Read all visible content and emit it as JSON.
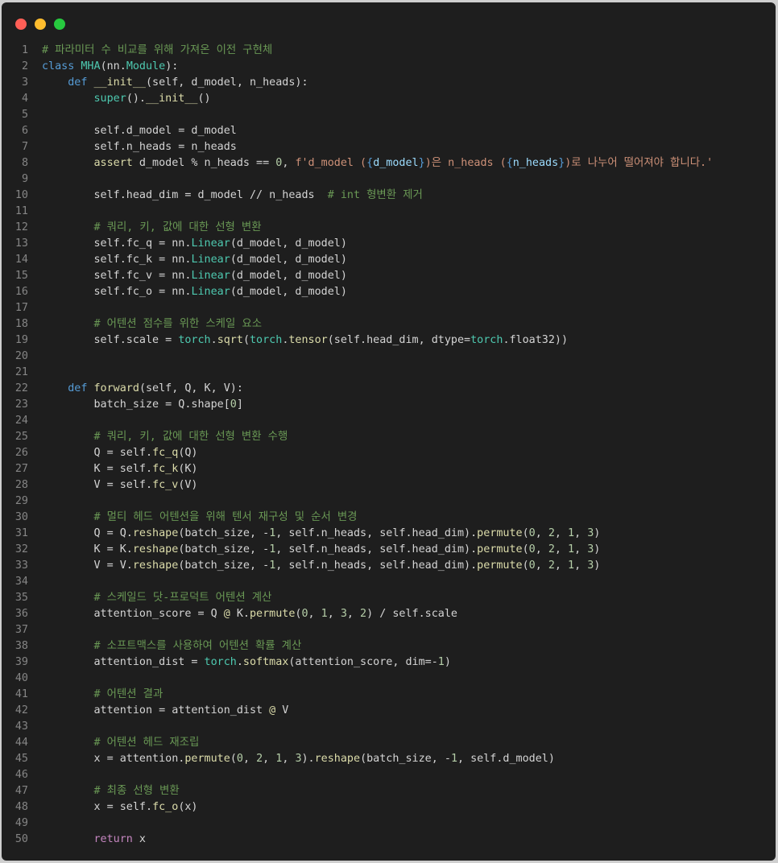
{
  "window": {
    "controls": {
      "close": "#ff5f56",
      "minimize": "#ffbd2e",
      "maximize": "#27c93f"
    },
    "background": "#1e1e1e"
  },
  "colors": {
    "comment": "#6a9955",
    "keyword": "#569cd6",
    "control": "#c586c0",
    "function": "#dcdcaa",
    "class": "#4ec9b0",
    "variable": "#9cdcfe",
    "number": "#b5cea8",
    "string": "#ce9178",
    "plain": "#d4d4d4",
    "line_number": "#858585"
  },
  "code": {
    "language": "python",
    "lines": [
      {
        "n": "1",
        "tokens": [
          [
            "comment",
            "# 파라미터 수 비교를 위해 가져온 이전 구현체"
          ]
        ]
      },
      {
        "n": "2",
        "tokens": [
          [
            "keyword",
            "class"
          ],
          [
            "plain",
            " "
          ],
          [
            "class",
            "MHA"
          ],
          [
            "plain",
            "(nn."
          ],
          [
            "class",
            "Module"
          ],
          [
            "plain",
            "):"
          ]
        ]
      },
      {
        "n": "3",
        "tokens": [
          [
            "plain",
            "    "
          ],
          [
            "keyword",
            "def"
          ],
          [
            "plain",
            " "
          ],
          [
            "function",
            "__init__"
          ],
          [
            "plain",
            "(self, d_model, n_heads):"
          ]
        ]
      },
      {
        "n": "4",
        "tokens": [
          [
            "plain",
            "        "
          ],
          [
            "class",
            "super"
          ],
          [
            "plain",
            "()."
          ],
          [
            "function",
            "__init__"
          ],
          [
            "plain",
            "()"
          ]
        ]
      },
      {
        "n": "5",
        "tokens": []
      },
      {
        "n": "6",
        "tokens": [
          [
            "plain",
            "        self.d_model = d_model"
          ]
        ]
      },
      {
        "n": "7",
        "tokens": [
          [
            "plain",
            "        self.n_heads = n_heads"
          ]
        ]
      },
      {
        "n": "8",
        "tokens": [
          [
            "plain",
            "        "
          ],
          [
            "function",
            "assert"
          ],
          [
            "plain",
            " d_model % n_heads == "
          ],
          [
            "number",
            "0"
          ],
          [
            "plain",
            ", "
          ],
          [
            "string",
            "f'd_model ("
          ],
          [
            "keyword",
            "{"
          ],
          [
            "variable",
            "d_model"
          ],
          [
            "keyword",
            "}"
          ],
          [
            "string",
            ")은 n_heads ("
          ],
          [
            "keyword",
            "{"
          ],
          [
            "variable",
            "n_heads"
          ],
          [
            "keyword",
            "}"
          ],
          [
            "string",
            ")로 나누어 떨어져야 합니다.'"
          ]
        ]
      },
      {
        "n": "9",
        "tokens": []
      },
      {
        "n": "10",
        "tokens": [
          [
            "plain",
            "        self.head_dim = d_model // n_heads  "
          ],
          [
            "comment",
            "# int 형변환 제거"
          ]
        ]
      },
      {
        "n": "11",
        "tokens": []
      },
      {
        "n": "12",
        "tokens": [
          [
            "plain",
            "        "
          ],
          [
            "comment",
            "# 쿼리, 키, 값에 대한 선형 변환"
          ]
        ]
      },
      {
        "n": "13",
        "tokens": [
          [
            "plain",
            "        self.fc_q = nn."
          ],
          [
            "class",
            "Linear"
          ],
          [
            "plain",
            "(d_model, d_model)"
          ]
        ]
      },
      {
        "n": "14",
        "tokens": [
          [
            "plain",
            "        self.fc_k = nn."
          ],
          [
            "class",
            "Linear"
          ],
          [
            "plain",
            "(d_model, d_model)"
          ]
        ]
      },
      {
        "n": "15",
        "tokens": [
          [
            "plain",
            "        self.fc_v = nn."
          ],
          [
            "class",
            "Linear"
          ],
          [
            "plain",
            "(d_model, d_model)"
          ]
        ]
      },
      {
        "n": "16",
        "tokens": [
          [
            "plain",
            "        self.fc_o = nn."
          ],
          [
            "class",
            "Linear"
          ],
          [
            "plain",
            "(d_model, d_model)"
          ]
        ]
      },
      {
        "n": "17",
        "tokens": []
      },
      {
        "n": "18",
        "tokens": [
          [
            "plain",
            "        "
          ],
          [
            "comment",
            "# 어텐션 점수를 위한 스케일 요소"
          ]
        ]
      },
      {
        "n": "19",
        "tokens": [
          [
            "plain",
            "        self.scale = "
          ],
          [
            "class",
            "torch"
          ],
          [
            "plain",
            "."
          ],
          [
            "function",
            "sqrt"
          ],
          [
            "plain",
            "("
          ],
          [
            "class",
            "torch"
          ],
          [
            "plain",
            "."
          ],
          [
            "function",
            "tensor"
          ],
          [
            "plain",
            "(self.head_dim, dtype="
          ],
          [
            "class",
            "torch"
          ],
          [
            "plain",
            ".float32))"
          ]
        ]
      },
      {
        "n": "20",
        "tokens": []
      },
      {
        "n": "21",
        "tokens": []
      },
      {
        "n": "22",
        "tokens": [
          [
            "plain",
            "    "
          ],
          [
            "keyword",
            "def"
          ],
          [
            "plain",
            " "
          ],
          [
            "function",
            "forward"
          ],
          [
            "plain",
            "(self, Q, K, V):"
          ]
        ]
      },
      {
        "n": "23",
        "tokens": [
          [
            "plain",
            "        batch_size = Q.shape["
          ],
          [
            "number",
            "0"
          ],
          [
            "plain",
            "]"
          ]
        ]
      },
      {
        "n": "24",
        "tokens": []
      },
      {
        "n": "25",
        "tokens": [
          [
            "plain",
            "        "
          ],
          [
            "comment",
            "# 쿼리, 키, 값에 대한 선형 변환 수행"
          ]
        ]
      },
      {
        "n": "26",
        "tokens": [
          [
            "plain",
            "        Q = self."
          ],
          [
            "function",
            "fc_q"
          ],
          [
            "plain",
            "(Q)"
          ]
        ]
      },
      {
        "n": "27",
        "tokens": [
          [
            "plain",
            "        K = self."
          ],
          [
            "function",
            "fc_k"
          ],
          [
            "plain",
            "(K)"
          ]
        ]
      },
      {
        "n": "28",
        "tokens": [
          [
            "plain",
            "        V = self."
          ],
          [
            "function",
            "fc_v"
          ],
          [
            "plain",
            "(V)"
          ]
        ]
      },
      {
        "n": "29",
        "tokens": []
      },
      {
        "n": "30",
        "tokens": [
          [
            "plain",
            "        "
          ],
          [
            "comment",
            "# 멀티 헤드 어텐션을 위해 텐서 재구성 및 순서 변경"
          ]
        ]
      },
      {
        "n": "31",
        "tokens": [
          [
            "plain",
            "        Q = Q."
          ],
          [
            "function",
            "reshape"
          ],
          [
            "plain",
            "(batch_size, -"
          ],
          [
            "number",
            "1"
          ],
          [
            "plain",
            ", self.n_heads, self.head_dim)."
          ],
          [
            "function",
            "permute"
          ],
          [
            "plain",
            "("
          ],
          [
            "number",
            "0"
          ],
          [
            "plain",
            ", "
          ],
          [
            "number",
            "2"
          ],
          [
            "plain",
            ", "
          ],
          [
            "number",
            "1"
          ],
          [
            "plain",
            ", "
          ],
          [
            "number",
            "3"
          ],
          [
            "plain",
            ")"
          ]
        ]
      },
      {
        "n": "32",
        "tokens": [
          [
            "plain",
            "        K = K."
          ],
          [
            "function",
            "reshape"
          ],
          [
            "plain",
            "(batch_size, -"
          ],
          [
            "number",
            "1"
          ],
          [
            "plain",
            ", self.n_heads, self.head_dim)."
          ],
          [
            "function",
            "permute"
          ],
          [
            "plain",
            "("
          ],
          [
            "number",
            "0"
          ],
          [
            "plain",
            ", "
          ],
          [
            "number",
            "2"
          ],
          [
            "plain",
            ", "
          ],
          [
            "number",
            "1"
          ],
          [
            "plain",
            ", "
          ],
          [
            "number",
            "3"
          ],
          [
            "plain",
            ")"
          ]
        ]
      },
      {
        "n": "33",
        "tokens": [
          [
            "plain",
            "        V = V."
          ],
          [
            "function",
            "reshape"
          ],
          [
            "plain",
            "(batch_size, -"
          ],
          [
            "number",
            "1"
          ],
          [
            "plain",
            ", self.n_heads, self.head_dim)."
          ],
          [
            "function",
            "permute"
          ],
          [
            "plain",
            "("
          ],
          [
            "number",
            "0"
          ],
          [
            "plain",
            ", "
          ],
          [
            "number",
            "2"
          ],
          [
            "plain",
            ", "
          ],
          [
            "number",
            "1"
          ],
          [
            "plain",
            ", "
          ],
          [
            "number",
            "3"
          ],
          [
            "plain",
            ")"
          ]
        ]
      },
      {
        "n": "34",
        "tokens": []
      },
      {
        "n": "35",
        "tokens": [
          [
            "plain",
            "        "
          ],
          [
            "comment",
            "# 스케일드 닷-프로덕트 어텐션 계산"
          ]
        ]
      },
      {
        "n": "36",
        "tokens": [
          [
            "plain",
            "        attention_score = Q "
          ],
          [
            "function",
            "@"
          ],
          [
            "plain",
            " K."
          ],
          [
            "function",
            "permute"
          ],
          [
            "plain",
            "("
          ],
          [
            "number",
            "0"
          ],
          [
            "plain",
            ", "
          ],
          [
            "number",
            "1"
          ],
          [
            "plain",
            ", "
          ],
          [
            "number",
            "3"
          ],
          [
            "plain",
            ", "
          ],
          [
            "number",
            "2"
          ],
          [
            "plain",
            ") / self.scale"
          ]
        ]
      },
      {
        "n": "37",
        "tokens": []
      },
      {
        "n": "38",
        "tokens": [
          [
            "plain",
            "        "
          ],
          [
            "comment",
            "# 소프트맥스를 사용하여 어텐션 확률 계산"
          ]
        ]
      },
      {
        "n": "39",
        "tokens": [
          [
            "plain",
            "        attention_dist = "
          ],
          [
            "class",
            "torch"
          ],
          [
            "plain",
            "."
          ],
          [
            "function",
            "softmax"
          ],
          [
            "plain",
            "(attention_score, dim=-"
          ],
          [
            "number",
            "1"
          ],
          [
            "plain",
            ")"
          ]
        ]
      },
      {
        "n": "40",
        "tokens": []
      },
      {
        "n": "41",
        "tokens": [
          [
            "plain",
            "        "
          ],
          [
            "comment",
            "# 어텐션 결과"
          ]
        ]
      },
      {
        "n": "42",
        "tokens": [
          [
            "plain",
            "        attention = attention_dist "
          ],
          [
            "function",
            "@"
          ],
          [
            "plain",
            " V"
          ]
        ]
      },
      {
        "n": "43",
        "tokens": []
      },
      {
        "n": "44",
        "tokens": [
          [
            "plain",
            "        "
          ],
          [
            "comment",
            "# 어텐션 헤드 재조립"
          ]
        ]
      },
      {
        "n": "45",
        "tokens": [
          [
            "plain",
            "        x = attention."
          ],
          [
            "function",
            "permute"
          ],
          [
            "plain",
            "("
          ],
          [
            "number",
            "0"
          ],
          [
            "plain",
            ", "
          ],
          [
            "number",
            "2"
          ],
          [
            "plain",
            ", "
          ],
          [
            "number",
            "1"
          ],
          [
            "plain",
            ", "
          ],
          [
            "number",
            "3"
          ],
          [
            "plain",
            ")."
          ],
          [
            "function",
            "reshape"
          ],
          [
            "plain",
            "(batch_size, -"
          ],
          [
            "number",
            "1"
          ],
          [
            "plain",
            ", self.d_model)"
          ]
        ]
      },
      {
        "n": "46",
        "tokens": []
      },
      {
        "n": "47",
        "tokens": [
          [
            "plain",
            "        "
          ],
          [
            "comment",
            "# 최종 선형 변환"
          ]
        ]
      },
      {
        "n": "48",
        "tokens": [
          [
            "plain",
            "        x = self."
          ],
          [
            "function",
            "fc_o"
          ],
          [
            "plain",
            "(x)"
          ]
        ]
      },
      {
        "n": "49",
        "tokens": []
      },
      {
        "n": "50",
        "tokens": [
          [
            "plain",
            "        "
          ],
          [
            "control",
            "return"
          ],
          [
            "plain",
            " x"
          ]
        ]
      }
    ]
  }
}
